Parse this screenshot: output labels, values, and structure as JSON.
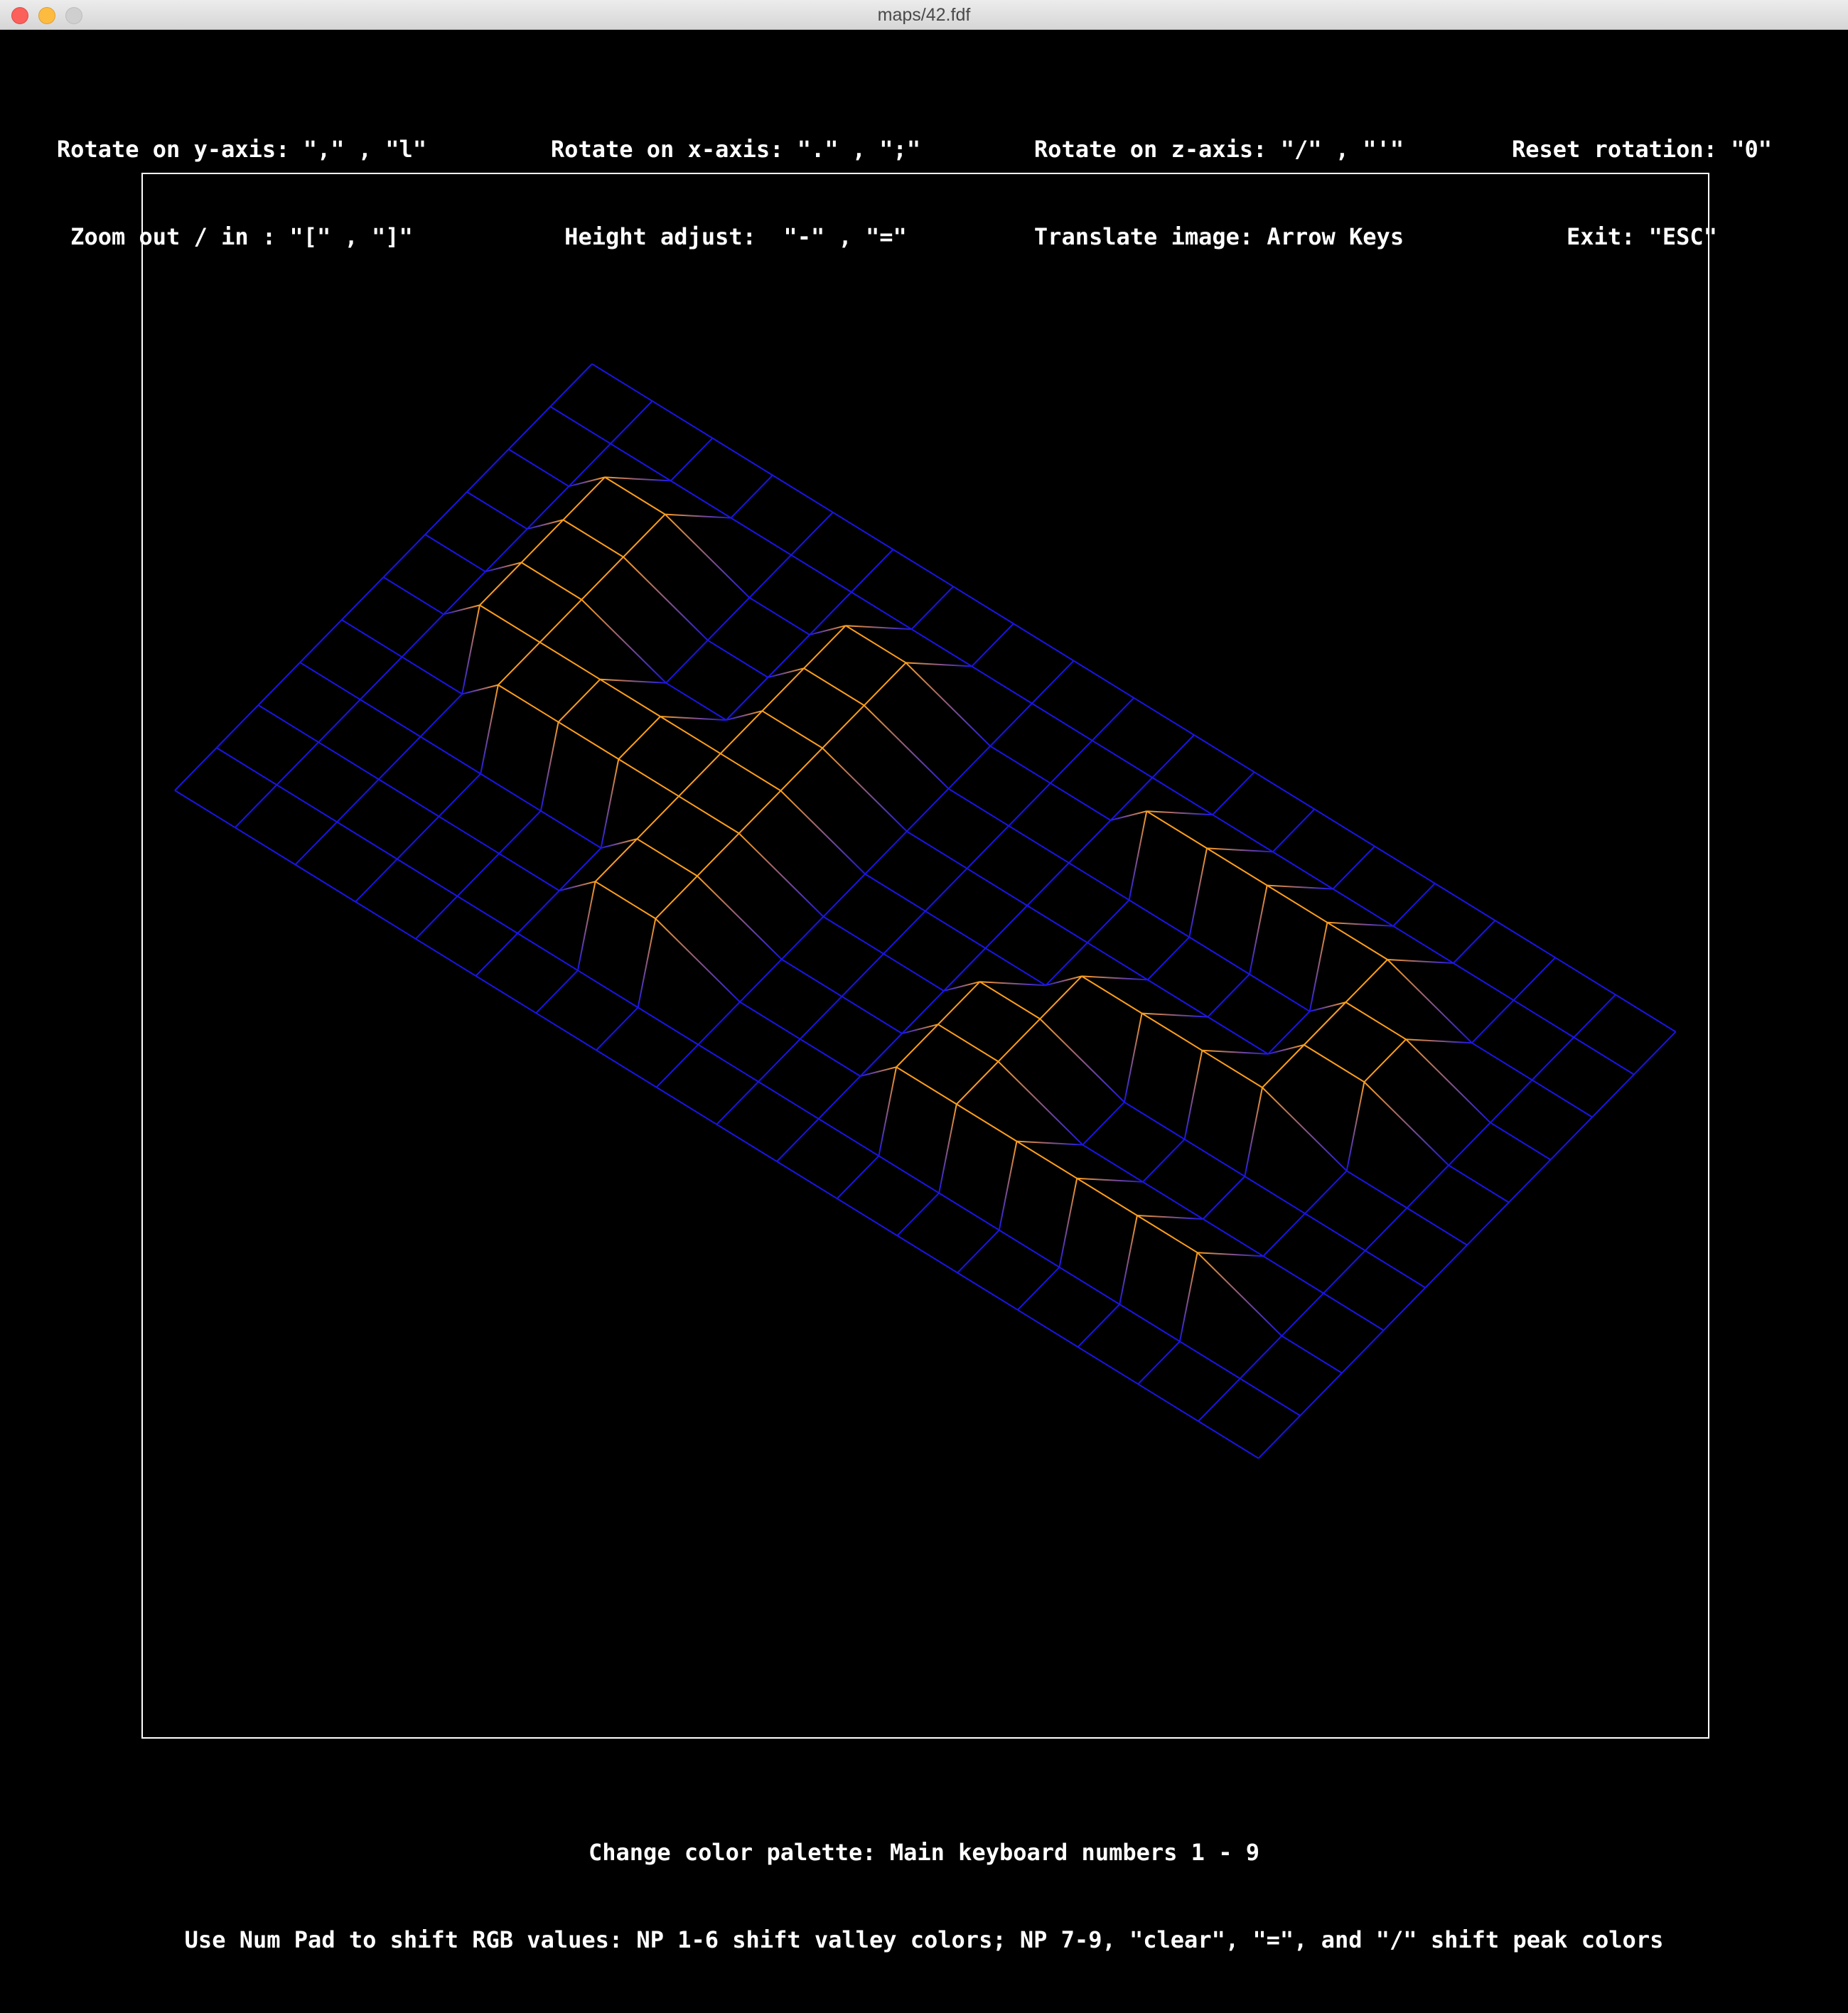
{
  "window": {
    "title": "maps/42.fdf"
  },
  "help": {
    "rotate_y": "Rotate on y-axis: \",\" , \"l\"",
    "zoom": "Zoom out / in : \"[\" , \"]\"",
    "rotate_x": "Rotate on x-axis: \".\" , \";\"",
    "height": "Height adjust:  \"-\" , \"=\"",
    "rotate_z": "Rotate on z-axis: \"/\" , \"'\"",
    "translate": "Translate image: Arrow Keys",
    "reset": "Reset rotation: \"0\"",
    "exit": "Exit: \"ESC\""
  },
  "footer": {
    "palette": "Change color palette: Main keyboard numbers 1 - 9",
    "numpad": "Use Num Pad to shift RGB values: NP 1-6 shift valley colors; NP 7-9, \"clear\", \"=\", and \"/\" shift peak colors"
  },
  "colors": {
    "valley": "#1a14e6",
    "peak": "#ff9f1c",
    "frame": "#ffffff",
    "background": "#000000"
  },
  "map": {
    "name": "42",
    "heights": [
      [
        0,
        0,
        0,
        0,
        0,
        0,
        0,
        0,
        0,
        0,
        0,
        0,
        0,
        0,
        0,
        0,
        0,
        0,
        0
      ],
      [
        0,
        0,
        0,
        0,
        0,
        0,
        0,
        0,
        0,
        0,
        0,
        0,
        0,
        0,
        0,
        0,
        0,
        0,
        0
      ],
      [
        0,
        0,
        10,
        10,
        0,
        0,
        10,
        10,
        0,
        0,
        0,
        10,
        10,
        10,
        10,
        10,
        0,
        0,
        0
      ],
      [
        0,
        0,
        10,
        10,
        0,
        0,
        10,
        10,
        0,
        0,
        0,
        0,
        0,
        0,
        0,
        10,
        10,
        0,
        0
      ],
      [
        0,
        0,
        10,
        10,
        0,
        0,
        10,
        10,
        0,
        0,
        0,
        0,
        0,
        0,
        0,
        10,
        10,
        0,
        0
      ],
      [
        0,
        0,
        10,
        10,
        10,
        10,
        10,
        10,
        0,
        0,
        0,
        0,
        10,
        10,
        10,
        10,
        0,
        0,
        0
      ],
      [
        0,
        0,
        0,
        10,
        10,
        10,
        10,
        10,
        0,
        0,
        0,
        10,
        10,
        0,
        0,
        0,
        0,
        0,
        0
      ],
      [
        0,
        0,
        0,
        0,
        0,
        0,
        10,
        10,
        0,
        0,
        0,
        10,
        10,
        0,
        0,
        0,
        0,
        0,
        0
      ],
      [
        0,
        0,
        0,
        0,
        0,
        0,
        10,
        10,
        0,
        0,
        0,
        10,
        10,
        10,
        10,
        10,
        10,
        0,
        0
      ],
      [
        0,
        0,
        0,
        0,
        0,
        0,
        0,
        0,
        0,
        0,
        0,
        0,
        0,
        0,
        0,
        0,
        0,
        0,
        0
      ],
      [
        0,
        0,
        0,
        0,
        0,
        0,
        0,
        0,
        0,
        0,
        0,
        0,
        0,
        0,
        0,
        0,
        0,
        0,
        0
      ]
    ]
  }
}
